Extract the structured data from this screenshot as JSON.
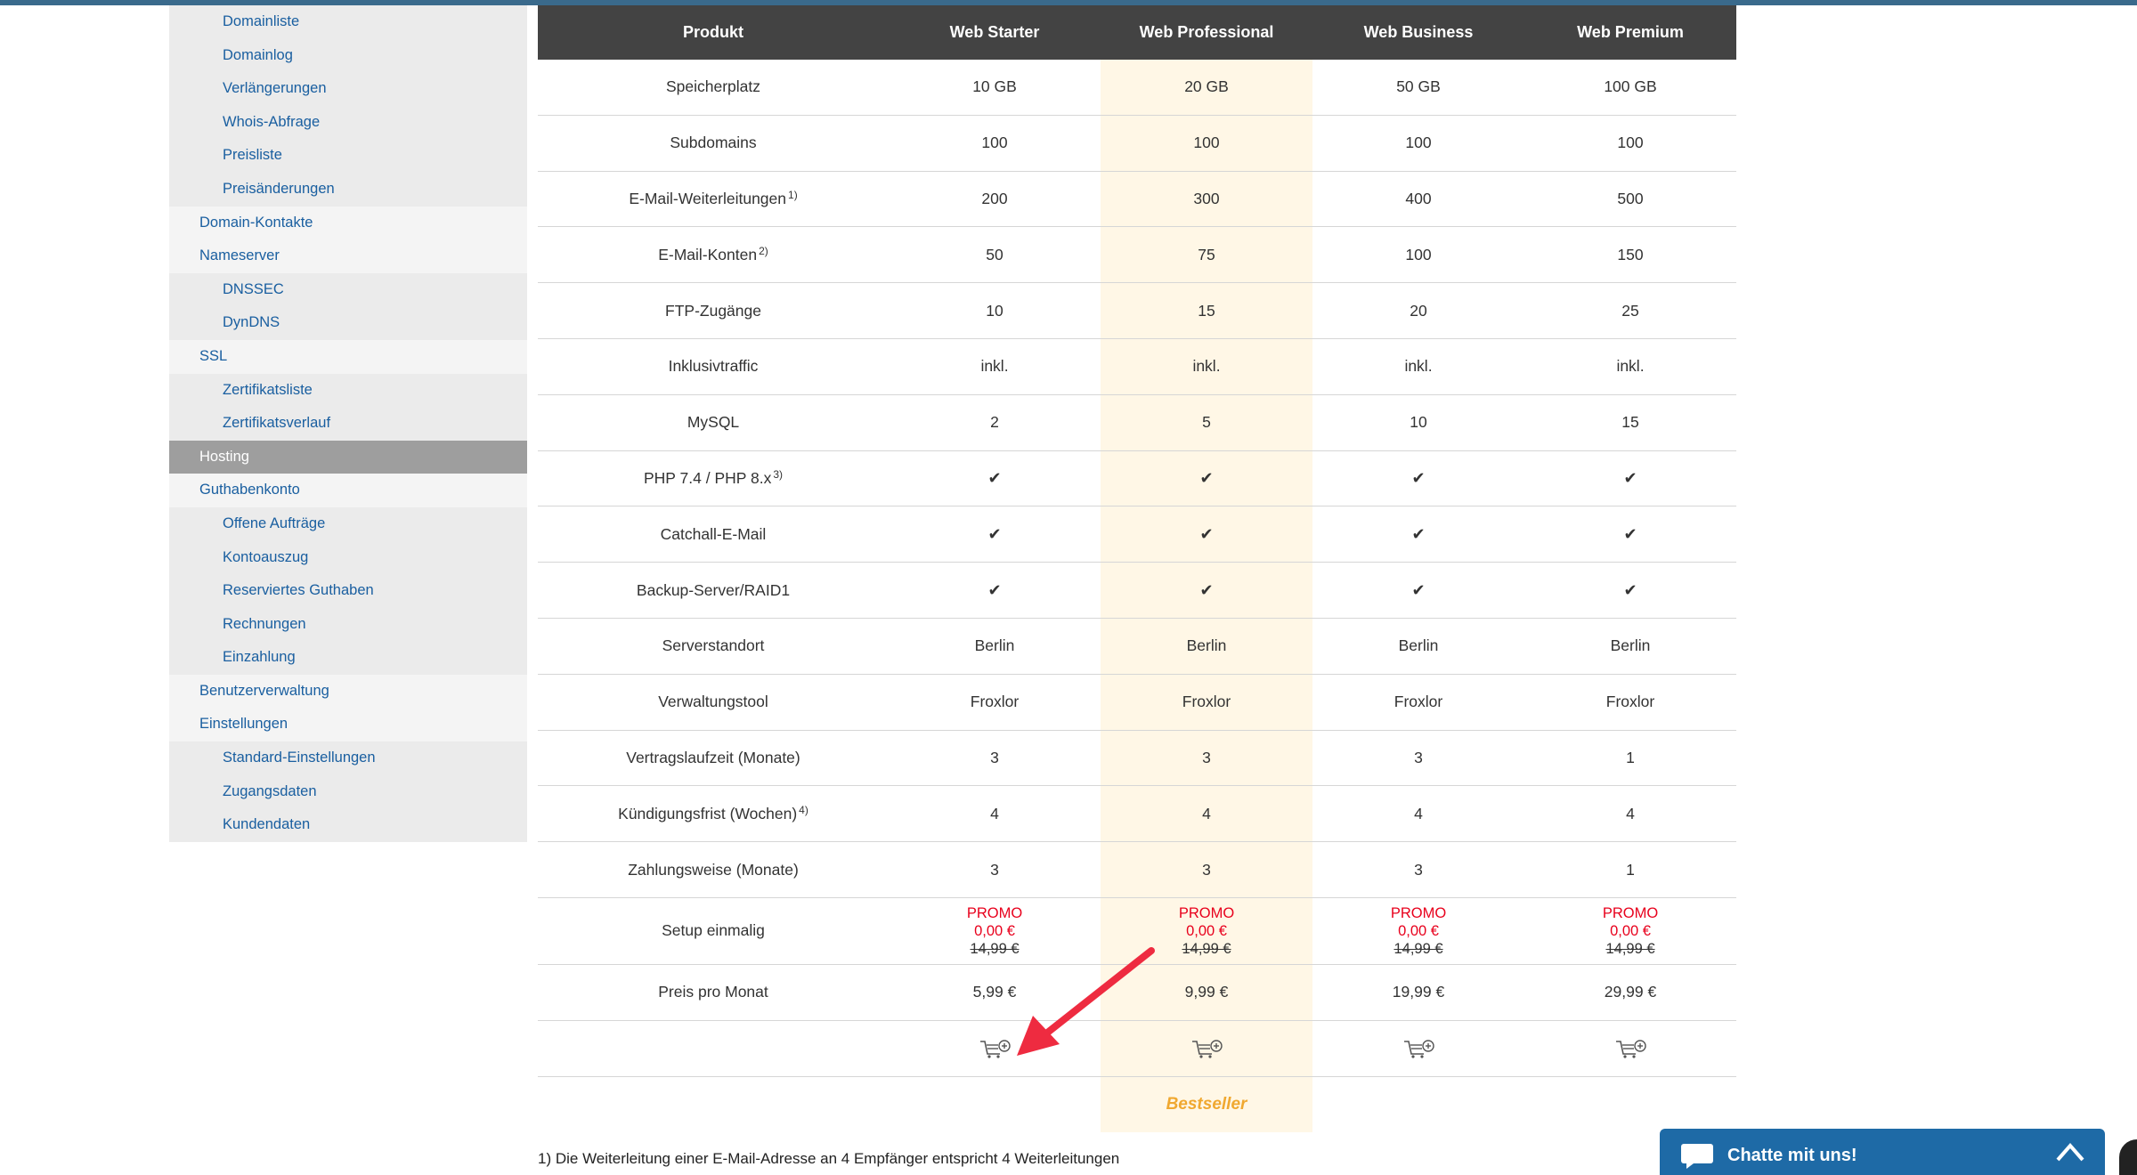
{
  "sidebar": {
    "items": [
      {
        "label": "Domainliste",
        "level": 2
      },
      {
        "label": "Domainlog",
        "level": 2
      },
      {
        "label": "Verlängerungen",
        "level": 2
      },
      {
        "label": "Whois-Abfrage",
        "level": 2
      },
      {
        "label": "Preisliste",
        "level": 2
      },
      {
        "label": "Preisänderungen",
        "level": 2
      },
      {
        "label": "Domain-Kontakte",
        "level": 1
      },
      {
        "label": "Nameserver",
        "level": 1
      },
      {
        "label": "DNSSEC",
        "level": 2
      },
      {
        "label": "DynDNS",
        "level": 2
      },
      {
        "label": "SSL",
        "level": 1
      },
      {
        "label": "Zertifikatsliste",
        "level": 2
      },
      {
        "label": "Zertifikatsverlauf",
        "level": 2
      },
      {
        "label": "Hosting",
        "level": 1,
        "active": true
      },
      {
        "label": "Guthabenkonto",
        "level": 1
      },
      {
        "label": "Offene Aufträge",
        "level": 2
      },
      {
        "label": "Kontoauszug",
        "level": 2
      },
      {
        "label": "Reserviertes Guthaben",
        "level": 2
      },
      {
        "label": "Rechnungen",
        "level": 2
      },
      {
        "label": "Einzahlung",
        "level": 2
      },
      {
        "label": "Benutzerverwaltung",
        "level": 1
      },
      {
        "label": "Einstellungen",
        "level": 1
      },
      {
        "label": "Standard-Einstellungen",
        "level": 2
      },
      {
        "label": "Zugangsdaten",
        "level": 2
      },
      {
        "label": "Kundendaten",
        "level": 2
      }
    ]
  },
  "table": {
    "header": [
      "Produkt",
      "Web Starter",
      "Web Professional",
      "Web Business",
      "Web Premium"
    ],
    "rows": [
      {
        "label": "Speicherplatz",
        "sup": "",
        "values": [
          "10 GB",
          "20 GB",
          "50 GB",
          "100 GB"
        ]
      },
      {
        "label": "Subdomains",
        "sup": "",
        "values": [
          "100",
          "100",
          "100",
          "100"
        ]
      },
      {
        "label": "E-Mail-Weiterleitungen",
        "sup": "1)",
        "values": [
          "200",
          "300",
          "400",
          "500"
        ]
      },
      {
        "label": "E-Mail-Konten",
        "sup": "2)",
        "values": [
          "50",
          "75",
          "100",
          "150"
        ]
      },
      {
        "label": "FTP-Zugänge",
        "sup": "",
        "values": [
          "10",
          "15",
          "20",
          "25"
        ]
      },
      {
        "label": "Inklusivtraffic",
        "sup": "",
        "values": [
          "inkl.",
          "inkl.",
          "inkl.",
          "inkl."
        ]
      },
      {
        "label": "MySQL",
        "sup": "",
        "values": [
          "2",
          "5",
          "10",
          "15"
        ]
      },
      {
        "label": "PHP 7.4 / PHP 8.x",
        "sup": "3)",
        "values": [
          "✔",
          "✔",
          "✔",
          "✔"
        ]
      },
      {
        "label": "Catchall-E-Mail",
        "sup": "",
        "values": [
          "✔",
          "✔",
          "✔",
          "✔"
        ]
      },
      {
        "label": "Backup-Server/RAID1",
        "sup": "",
        "values": [
          "✔",
          "✔",
          "✔",
          "✔"
        ]
      },
      {
        "label": "Serverstandort",
        "sup": "",
        "values": [
          "Berlin",
          "Berlin",
          "Berlin",
          "Berlin"
        ]
      },
      {
        "label": "Verwaltungstool",
        "sup": "",
        "values": [
          "Froxlor",
          "Froxlor",
          "Froxlor",
          "Froxlor"
        ]
      },
      {
        "label": "Vertragslaufzeit (Monate)",
        "sup": "",
        "values": [
          "3",
          "3",
          "3",
          "1"
        ]
      },
      {
        "label": "Kündigungsfrist (Wochen)",
        "sup": "4)",
        "values": [
          "4",
          "4",
          "4",
          "4"
        ]
      },
      {
        "label": "Zahlungsweise (Monate)",
        "sup": "",
        "values": [
          "3",
          "3",
          "3",
          "1"
        ]
      }
    ],
    "setup": {
      "label": "Setup einmalig",
      "promo": "PROMO",
      "promo_price": "0,00 €",
      "old_price": "14,99 €"
    },
    "price": {
      "label": "Preis pro Monat",
      "values": [
        "5,99 €",
        "9,99 €",
        "19,99 €",
        "29,99 €"
      ]
    },
    "bestseller": "Bestseller",
    "highlight_color": "#fff7e6"
  },
  "footnote": "1) Die Weiterleitung einer E-Mail-Adresse an 4 Empfänger entspricht 4 Weiterleitungen",
  "chat": {
    "label": "Chatte mit uns!"
  },
  "colors": {
    "accent": "#1e6aa6",
    "promo": "#e8001c",
    "bestseller": "#f0a830",
    "header_bg": "#434343"
  }
}
